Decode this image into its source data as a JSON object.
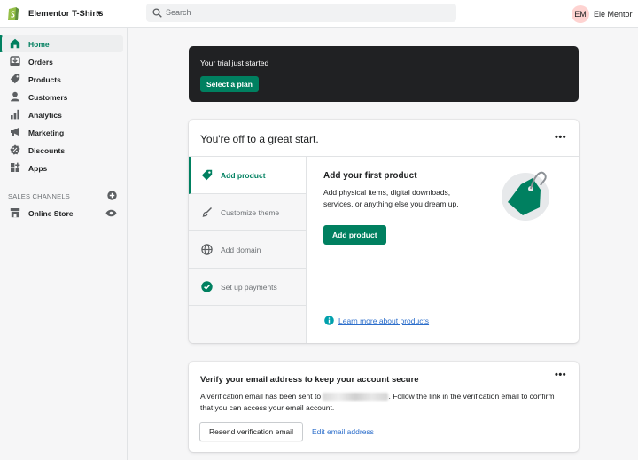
{
  "topbar": {
    "store_name": "Elementor T-Shirts",
    "search_placeholder": "Search",
    "user_initials": "EM",
    "user_name": "Ele Mentor"
  },
  "sidebar": {
    "items": [
      {
        "label": "Home",
        "icon": "home-icon"
      },
      {
        "label": "Orders",
        "icon": "orders-icon"
      },
      {
        "label": "Products",
        "icon": "tag-icon"
      },
      {
        "label": "Customers",
        "icon": "person-icon"
      },
      {
        "label": "Analytics",
        "icon": "bar-chart-icon"
      },
      {
        "label": "Marketing",
        "icon": "megaphone-icon"
      },
      {
        "label": "Discounts",
        "icon": "discount-icon"
      },
      {
        "label": "Apps",
        "icon": "apps-icon"
      }
    ],
    "channels_title": "SALES CHANNELS",
    "online_store": "Online Store"
  },
  "trial": {
    "text": "Your trial just started",
    "button": "Select a plan"
  },
  "setup": {
    "title": "You're off to a great start.",
    "more": "•••",
    "steps": [
      {
        "label": "Add product",
        "icon": "tag-icon"
      },
      {
        "label": "Customize theme",
        "icon": "brush-icon"
      },
      {
        "label": "Add domain",
        "icon": "globe-icon"
      },
      {
        "label": "Set up payments",
        "icon": "check-circle-icon"
      }
    ],
    "content_title": "Add your first product",
    "content_desc": "Add physical items, digital downloads, services, or anything else you dream up.",
    "content_button": "Add product",
    "learn_link": "Learn more about products"
  },
  "verify": {
    "title": "Verify your email address to keep your account secure",
    "desc_before": "A verification email has been sent to",
    "desc_after": ". Follow the link in the verification email to confirm that you can access your email account.",
    "more": "•••",
    "resend_button": "Resend verification email",
    "edit_link": "Edit email address"
  },
  "colors": {
    "brand_green": "#008060",
    "banner_dark": "#202123",
    "link_blue": "#2c6ecb"
  }
}
